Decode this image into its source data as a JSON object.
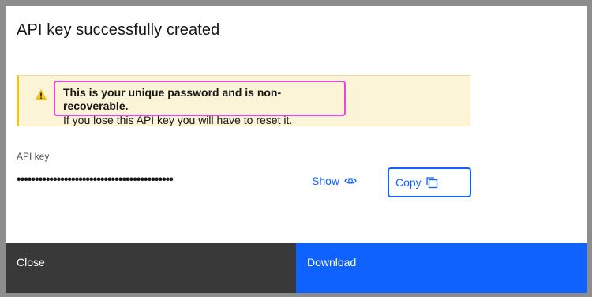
{
  "modal": {
    "title": "API key successfully created"
  },
  "notice": {
    "icon": "warning-icon",
    "title": "This is your unique password and is non-recoverable.",
    "subtitle": "If you lose this API key you will have to reset it.",
    "colors": {
      "background": "#fcf4d6",
      "accent": "#f1c21b",
      "highlight": "#e64bd5"
    }
  },
  "api_key": {
    "label": "API key",
    "masked_value": "•••••••••••••••••••••••••••••••••••••••••••",
    "show_label": "Show",
    "show_icon": "eye-icon",
    "copy_label": "Copy",
    "copy_icon": "copy-icon"
  },
  "footer": {
    "close_label": "Close",
    "download_label": "Download",
    "colors": {
      "secondary": "#393939",
      "primary": "#0f62fe"
    }
  }
}
